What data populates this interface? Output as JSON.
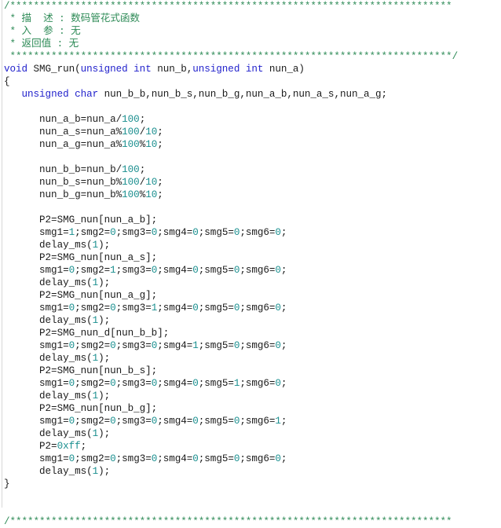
{
  "app": {
    "view": "source-code-editor",
    "language": "c",
    "background_color": "#ffffff",
    "colors": {
      "comment": "#2e8b57",
      "keyword": "#2222cc",
      "number": "#1a8f8f",
      "plain": "#1a1a1a",
      "gutter_rule": "#d8d8d8"
    }
  },
  "code": {
    "lines": [
      [
        {
          "t": "cmt",
          "s": "/***************************************************************************"
        }
      ],
      [
        {
          "t": "cmt",
          "s": " * 描  述 : 数码管花式函数"
        }
      ],
      [
        {
          "t": "cmt",
          "s": " * 入  参 : 无"
        }
      ],
      [
        {
          "t": "cmt",
          "s": " * 返回值 : 无"
        }
      ],
      [
        {
          "t": "cmt",
          "s": " ***************************************************************************/"
        }
      ],
      [
        {
          "t": "kw",
          "s": "void"
        },
        {
          "t": "pln",
          "s": " SMG_run("
        },
        {
          "t": "kw",
          "s": "unsigned int"
        },
        {
          "t": "pln",
          "s": " nun_b,"
        },
        {
          "t": "kw",
          "s": "unsigned int"
        },
        {
          "t": "pln",
          "s": " nun_a)"
        }
      ],
      [
        {
          "t": "pln",
          "s": "{"
        }
      ],
      [
        {
          "t": "pln",
          "s": "   "
        },
        {
          "t": "kw",
          "s": "unsigned char"
        },
        {
          "t": "pln",
          "s": " nun_b_b,nun_b_s,nun_b_g,nun_a_b,nun_a_s,nun_a_g;"
        }
      ],
      [
        {
          "t": "pln",
          "s": ""
        }
      ],
      [
        {
          "t": "pln",
          "s": "      nun_a_b=nun_a/"
        },
        {
          "t": "num",
          "s": "100"
        },
        {
          "t": "pln",
          "s": ";"
        }
      ],
      [
        {
          "t": "pln",
          "s": "      nun_a_s=nun_a%"
        },
        {
          "t": "num",
          "s": "100"
        },
        {
          "t": "pln",
          "s": "/"
        },
        {
          "t": "num",
          "s": "10"
        },
        {
          "t": "pln",
          "s": ";"
        }
      ],
      [
        {
          "t": "pln",
          "s": "      nun_a_g=nun_a%"
        },
        {
          "t": "num",
          "s": "100"
        },
        {
          "t": "pln",
          "s": "%"
        },
        {
          "t": "num",
          "s": "10"
        },
        {
          "t": "pln",
          "s": ";"
        }
      ],
      [
        {
          "t": "pln",
          "s": ""
        }
      ],
      [
        {
          "t": "pln",
          "s": "      nun_b_b=nun_b/"
        },
        {
          "t": "num",
          "s": "100"
        },
        {
          "t": "pln",
          "s": ";"
        }
      ],
      [
        {
          "t": "pln",
          "s": "      nun_b_s=nun_b%"
        },
        {
          "t": "num",
          "s": "100"
        },
        {
          "t": "pln",
          "s": "/"
        },
        {
          "t": "num",
          "s": "10"
        },
        {
          "t": "pln",
          "s": ";"
        }
      ],
      [
        {
          "t": "pln",
          "s": "      nun_b_g=nun_b%"
        },
        {
          "t": "num",
          "s": "100"
        },
        {
          "t": "pln",
          "s": "%"
        },
        {
          "t": "num",
          "s": "10"
        },
        {
          "t": "pln",
          "s": ";"
        }
      ],
      [
        {
          "t": "pln",
          "s": ""
        }
      ],
      [
        {
          "t": "pln",
          "s": "      P2=SMG_nun[nun_a_b];"
        }
      ],
      [
        {
          "t": "pln",
          "s": "      smg1="
        },
        {
          "t": "num",
          "s": "1"
        },
        {
          "t": "pln",
          "s": ";smg2="
        },
        {
          "t": "num",
          "s": "0"
        },
        {
          "t": "pln",
          "s": ";smg3="
        },
        {
          "t": "num",
          "s": "0"
        },
        {
          "t": "pln",
          "s": ";smg4="
        },
        {
          "t": "num",
          "s": "0"
        },
        {
          "t": "pln",
          "s": ";smg5="
        },
        {
          "t": "num",
          "s": "0"
        },
        {
          "t": "pln",
          "s": ";smg6="
        },
        {
          "t": "num",
          "s": "0"
        },
        {
          "t": "pln",
          "s": ";"
        }
      ],
      [
        {
          "t": "pln",
          "s": "      delay_ms("
        },
        {
          "t": "num",
          "s": "1"
        },
        {
          "t": "pln",
          "s": ");"
        }
      ],
      [
        {
          "t": "pln",
          "s": "      P2=SMG_nun[nun_a_s];"
        }
      ],
      [
        {
          "t": "pln",
          "s": "      smg1="
        },
        {
          "t": "num",
          "s": "0"
        },
        {
          "t": "pln",
          "s": ";smg2="
        },
        {
          "t": "num",
          "s": "1"
        },
        {
          "t": "pln",
          "s": ";smg3="
        },
        {
          "t": "num",
          "s": "0"
        },
        {
          "t": "pln",
          "s": ";smg4="
        },
        {
          "t": "num",
          "s": "0"
        },
        {
          "t": "pln",
          "s": ";smg5="
        },
        {
          "t": "num",
          "s": "0"
        },
        {
          "t": "pln",
          "s": ";smg6="
        },
        {
          "t": "num",
          "s": "0"
        },
        {
          "t": "pln",
          "s": ";"
        }
      ],
      [
        {
          "t": "pln",
          "s": "      delay_ms("
        },
        {
          "t": "num",
          "s": "1"
        },
        {
          "t": "pln",
          "s": ");"
        }
      ],
      [
        {
          "t": "pln",
          "s": "      P2=SMG_nun[nun_a_g];"
        }
      ],
      [
        {
          "t": "pln",
          "s": "      smg1="
        },
        {
          "t": "num",
          "s": "0"
        },
        {
          "t": "pln",
          "s": ";smg2="
        },
        {
          "t": "num",
          "s": "0"
        },
        {
          "t": "pln",
          "s": ";smg3="
        },
        {
          "t": "num",
          "s": "1"
        },
        {
          "t": "pln",
          "s": ";smg4="
        },
        {
          "t": "num",
          "s": "0"
        },
        {
          "t": "pln",
          "s": ";smg5="
        },
        {
          "t": "num",
          "s": "0"
        },
        {
          "t": "pln",
          "s": ";smg6="
        },
        {
          "t": "num",
          "s": "0"
        },
        {
          "t": "pln",
          "s": ";"
        }
      ],
      [
        {
          "t": "pln",
          "s": "      delay_ms("
        },
        {
          "t": "num",
          "s": "1"
        },
        {
          "t": "pln",
          "s": ");"
        }
      ],
      [
        {
          "t": "pln",
          "s": "      P2=SMG_nun_d[nun_b_b];"
        }
      ],
      [
        {
          "t": "pln",
          "s": "      smg1="
        },
        {
          "t": "num",
          "s": "0"
        },
        {
          "t": "pln",
          "s": ";smg2="
        },
        {
          "t": "num",
          "s": "0"
        },
        {
          "t": "pln",
          "s": ";smg3="
        },
        {
          "t": "num",
          "s": "0"
        },
        {
          "t": "pln",
          "s": ";smg4="
        },
        {
          "t": "num",
          "s": "1"
        },
        {
          "t": "pln",
          "s": ";smg5="
        },
        {
          "t": "num",
          "s": "0"
        },
        {
          "t": "pln",
          "s": ";smg6="
        },
        {
          "t": "num",
          "s": "0"
        },
        {
          "t": "pln",
          "s": ";"
        }
      ],
      [
        {
          "t": "pln",
          "s": "      delay_ms("
        },
        {
          "t": "num",
          "s": "1"
        },
        {
          "t": "pln",
          "s": ");"
        }
      ],
      [
        {
          "t": "pln",
          "s": "      P2=SMG_nun[nun_b_s];"
        }
      ],
      [
        {
          "t": "pln",
          "s": "      smg1="
        },
        {
          "t": "num",
          "s": "0"
        },
        {
          "t": "pln",
          "s": ";smg2="
        },
        {
          "t": "num",
          "s": "0"
        },
        {
          "t": "pln",
          "s": ";smg3="
        },
        {
          "t": "num",
          "s": "0"
        },
        {
          "t": "pln",
          "s": ";smg4="
        },
        {
          "t": "num",
          "s": "0"
        },
        {
          "t": "pln",
          "s": ";smg5="
        },
        {
          "t": "num",
          "s": "1"
        },
        {
          "t": "pln",
          "s": ";smg6="
        },
        {
          "t": "num",
          "s": "0"
        },
        {
          "t": "pln",
          "s": ";"
        }
      ],
      [
        {
          "t": "pln",
          "s": "      delay_ms("
        },
        {
          "t": "num",
          "s": "1"
        },
        {
          "t": "pln",
          "s": ");"
        }
      ],
      [
        {
          "t": "pln",
          "s": "      P2=SMG_nun[nun_b_g];"
        }
      ],
      [
        {
          "t": "pln",
          "s": "      smg1="
        },
        {
          "t": "num",
          "s": "0"
        },
        {
          "t": "pln",
          "s": ";smg2="
        },
        {
          "t": "num",
          "s": "0"
        },
        {
          "t": "pln",
          "s": ";smg3="
        },
        {
          "t": "num",
          "s": "0"
        },
        {
          "t": "pln",
          "s": ";smg4="
        },
        {
          "t": "num",
          "s": "0"
        },
        {
          "t": "pln",
          "s": ";smg5="
        },
        {
          "t": "num",
          "s": "0"
        },
        {
          "t": "pln",
          "s": ";smg6="
        },
        {
          "t": "num",
          "s": "1"
        },
        {
          "t": "pln",
          "s": ";"
        }
      ],
      [
        {
          "t": "pln",
          "s": "      delay_ms("
        },
        {
          "t": "num",
          "s": "1"
        },
        {
          "t": "pln",
          "s": ");"
        }
      ],
      [
        {
          "t": "pln",
          "s": "      P2="
        },
        {
          "t": "num",
          "s": "0xff"
        },
        {
          "t": "pln",
          "s": ";"
        }
      ],
      [
        {
          "t": "pln",
          "s": "      smg1="
        },
        {
          "t": "num",
          "s": "0"
        },
        {
          "t": "pln",
          "s": ";smg2="
        },
        {
          "t": "num",
          "s": "0"
        },
        {
          "t": "pln",
          "s": ";smg3="
        },
        {
          "t": "num",
          "s": "0"
        },
        {
          "t": "pln",
          "s": ";smg4="
        },
        {
          "t": "num",
          "s": "0"
        },
        {
          "t": "pln",
          "s": ";smg5="
        },
        {
          "t": "num",
          "s": "0"
        },
        {
          "t": "pln",
          "s": ";smg6="
        },
        {
          "t": "num",
          "s": "0"
        },
        {
          "t": "pln",
          "s": ";"
        }
      ],
      [
        {
          "t": "pln",
          "s": "      delay_ms("
        },
        {
          "t": "num",
          "s": "1"
        },
        {
          "t": "pln",
          "s": ");"
        }
      ],
      [
        {
          "t": "pln",
          "s": "}"
        }
      ],
      [
        {
          "t": "pln",
          "s": ""
        }
      ],
      [
        {
          "t": "pln",
          "s": ""
        }
      ],
      [
        {
          "t": "cmt",
          "s": "/***************************************************************************"
        }
      ]
    ]
  }
}
